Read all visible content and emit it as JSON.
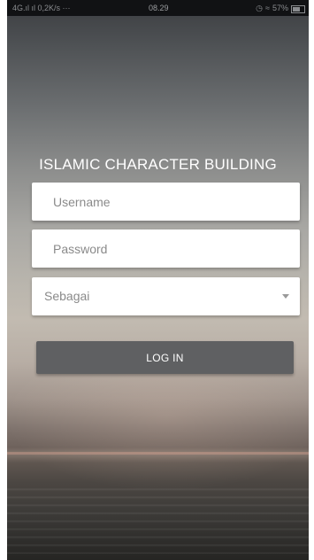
{
  "status_bar": {
    "network": "4G.ıl ıl 0,2K/s ···",
    "time": "08.29",
    "battery_percent": "57%",
    "battery_level": 0.57
  },
  "app": {
    "title": "ISLAMIC CHARACTER BUILDING"
  },
  "form": {
    "username": {
      "placeholder": "Username",
      "value": ""
    },
    "password": {
      "placeholder": "Password",
      "value": ""
    },
    "role_select": {
      "selected": "Sebagai"
    },
    "login_label": "LOG IN"
  },
  "colors": {
    "button_bg": "#5f6062",
    "field_bg": "#ffffff",
    "title_text": "#ffffff"
  }
}
